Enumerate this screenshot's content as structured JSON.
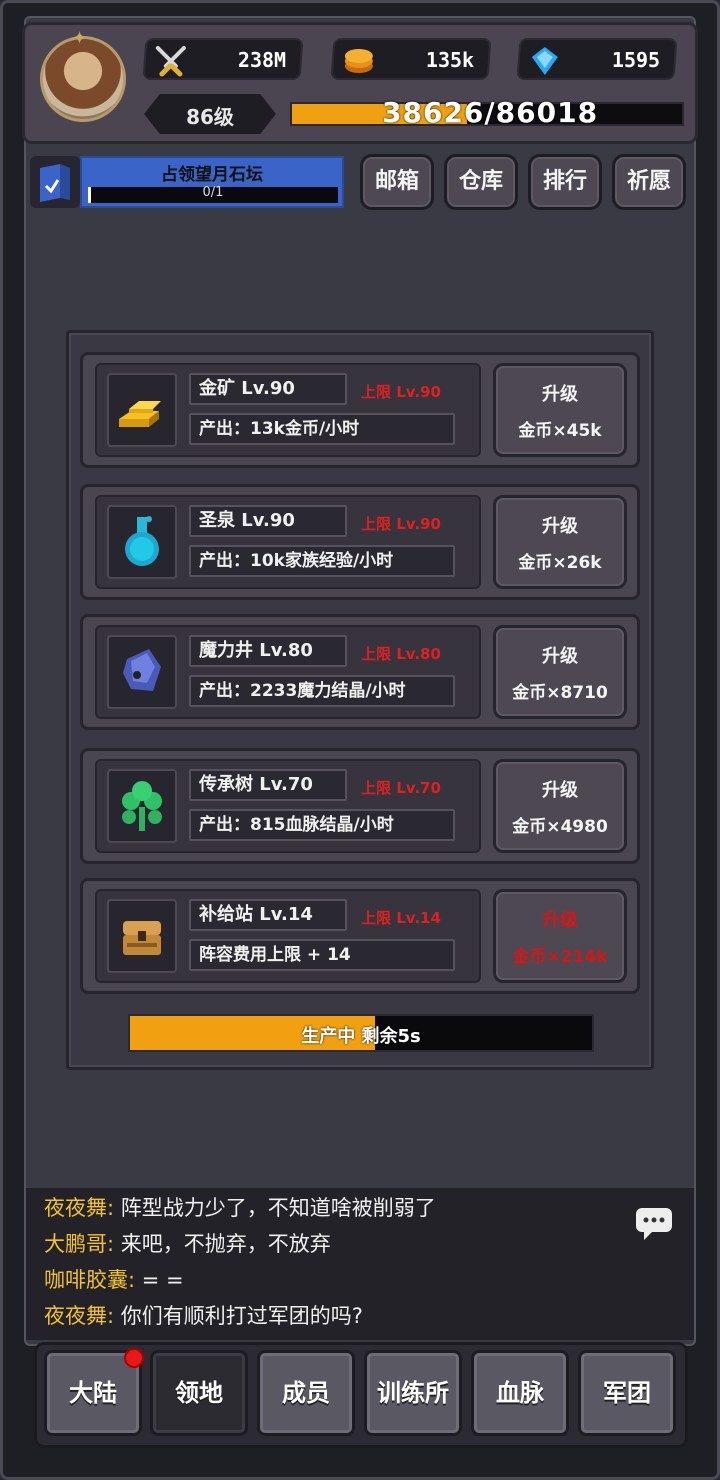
{
  "header": {
    "power": "238M",
    "gold": "135k",
    "gems": "1595",
    "level": "86级",
    "xp_text": "38626/86018",
    "xp_current": 38626,
    "xp_max": 86018
  },
  "quest": {
    "title": "占领望月石坛",
    "progress_text": "0/1",
    "progress_fraction": 0.0
  },
  "top_buttons": {
    "mail": "邮箱",
    "warehouse": "仓库",
    "ranking": "排行",
    "wish": "祈愿"
  },
  "buildings": [
    {
      "name": "金矿 Lv.90",
      "cap": "上限 Lv.90",
      "output": "产出：13k金币/小时",
      "up_label": "升级",
      "cost": "金币×45k",
      "icon": "gold-bars-icon",
      "can_upgrade": true
    },
    {
      "name": "圣泉 Lv.90",
      "cap": "上限 Lv.90",
      "output": "产出：10k家族经验/小时",
      "up_label": "升级",
      "cost": "金币×26k",
      "icon": "potion-flask-icon",
      "can_upgrade": true
    },
    {
      "name": "魔力井 Lv.80",
      "cap": "上限 Lv.80",
      "output": "产出：2233魔力结晶/小时",
      "up_label": "升级",
      "cost": "金币×8710",
      "icon": "crystal-icon",
      "can_upgrade": true
    },
    {
      "name": "传承树 Lv.70",
      "cap": "上限 Lv.70",
      "output": "产出：815血脉结晶/小时",
      "up_label": "升级",
      "cost": "金币×4980",
      "icon": "tree-icon",
      "can_upgrade": true
    },
    {
      "name": "补给站 Lv.14",
      "cap": "上限 Lv.14",
      "output": "阵容费用上限 + 14",
      "up_label": "升级",
      "cost": "金币×214k",
      "icon": "chest-icon",
      "can_upgrade": false
    }
  ],
  "production": {
    "text": "生产中 剩余5s",
    "progress_fraction": 0.53
  },
  "chat": [
    {
      "name": "夜夜舞:",
      "msg": " 阵型战力少了，不知道啥被削弱了"
    },
    {
      "name": "大鹏哥:",
      "msg": " 来吧，不抛弃，不放弃"
    },
    {
      "name": "咖啡胶囊:",
      "msg": " = ="
    },
    {
      "name": "夜夜舞:",
      "msg": " 你们有顺利打过军团的吗?"
    }
  ],
  "nav": {
    "items": [
      "大陆",
      "领地",
      "成员",
      "训练所",
      "血脉",
      "军团"
    ],
    "active_index": 1
  },
  "colors": {
    "accent_orange": "#f0a010",
    "cap_red": "#e02020",
    "chat_name_yellow": "#f2c230",
    "quest_blue": "#3a64c8"
  }
}
